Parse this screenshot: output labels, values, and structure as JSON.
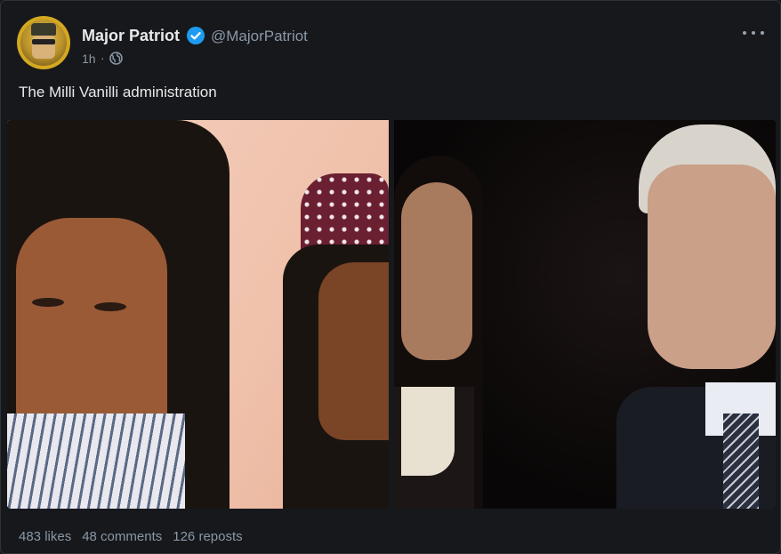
{
  "author": {
    "name": "Major Patriot",
    "handle": "@MajorPatriot",
    "verified": true,
    "time": "1h",
    "separator": "·",
    "visibility_icon": "globe-icon"
  },
  "post": {
    "text": "The Milli Vanilli administration",
    "media": [
      {
        "alt_icon": "photo-image"
      },
      {
        "alt_icon": "photo-image"
      }
    ]
  },
  "stats": {
    "likes": "483 likes",
    "comments": "48 comments",
    "reposts": "126 reposts"
  },
  "menu_icon": "more-icon",
  "colors": {
    "background": "#16181c",
    "border": "#2f3336",
    "text": "#e7e9ea",
    "muted": "#8b98a5",
    "verified": "#1d9bf0"
  }
}
